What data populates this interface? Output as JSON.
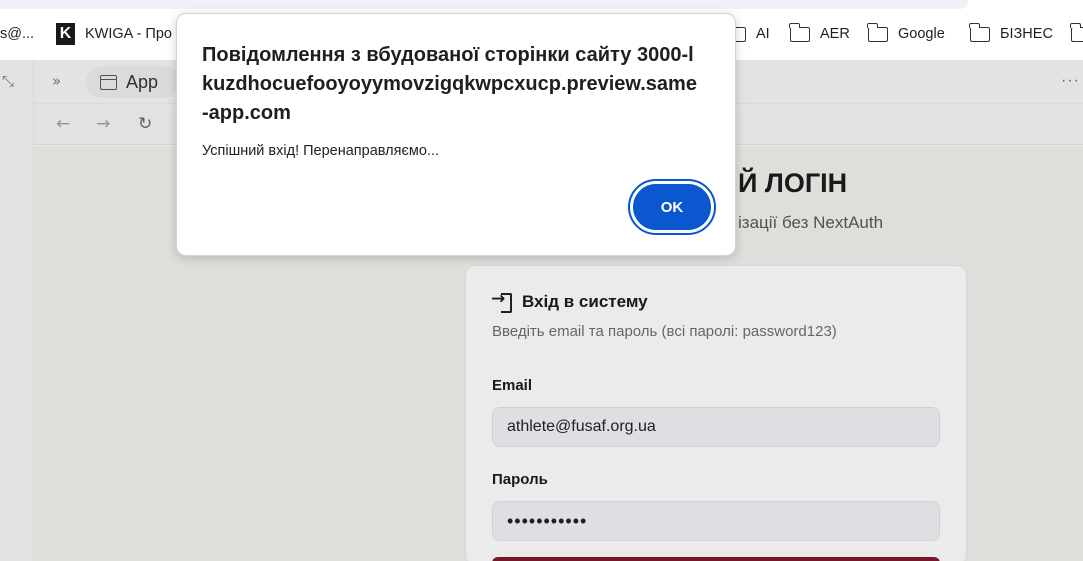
{
  "bookmarks": [
    {
      "label": "s@...",
      "icon": "none"
    },
    {
      "label": "KWIGA - Про",
      "icon": "kwiga-logo"
    },
    {
      "label": "AI",
      "icon": "folder-icon"
    },
    {
      "label": "AER",
      "icon": "folder-icon"
    },
    {
      "label": "Google",
      "icon": "folder-icon"
    },
    {
      "label": "БІЗНЕС",
      "icon": "folder-icon"
    }
  ],
  "kwiga_letter": "K",
  "tab": {
    "label": "App"
  },
  "page": {
    "title": "Й ЛОГІН",
    "subtitle": "ізації без NextAuth"
  },
  "login_card": {
    "heading": "Вхід в систему",
    "description": "Введіть email та пароль (всі паролі: password123)",
    "email_label": "Email",
    "email_value": "athlete@fusaf.org.ua",
    "password_label": "Пароль",
    "password_value": "•••••••••••"
  },
  "dialog": {
    "title": "Повідомлення з вбудованої сторінки сайту 3000-lkuzdhocuefooyoyymovzigqkwpcxucp.preview.same-app.com",
    "message": "Успішний вхід! Перенаправляємо...",
    "ok_label": "OK"
  },
  "colors": {
    "ok_button": "#0b57d0",
    "submit_button": "#7a1a2a"
  }
}
